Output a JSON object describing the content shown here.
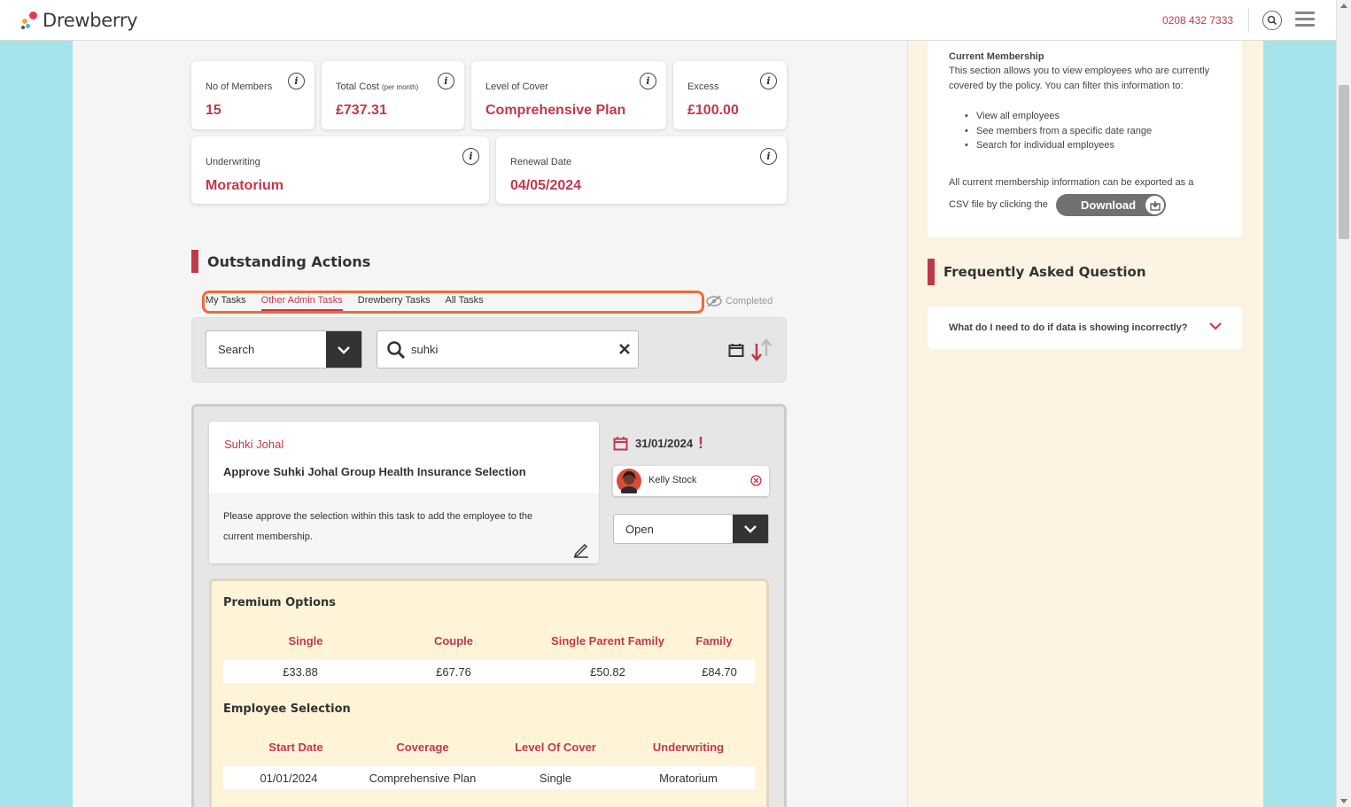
{
  "header": {
    "brand": "Drewberry",
    "phone": "0208 432 7333"
  },
  "stats": {
    "members": {
      "label": "No of Members",
      "value": "15"
    },
    "cost": {
      "label": "Total Cost",
      "sub": "(per month)",
      "value": "£737.31"
    },
    "cover": {
      "label": "Level of Cover",
      "value": "Comprehensive Plan"
    },
    "excess": {
      "label": "Excess",
      "value": "£100.00"
    },
    "underwriting": {
      "label": "Underwriting",
      "value": "Moratorium"
    },
    "renewal": {
      "label": "Renewal Date",
      "value": "04/05/2024"
    }
  },
  "actions": {
    "title": "Outstanding Actions",
    "tabs": [
      "My Tasks",
      "Other Admin Tasks",
      "Drewberry Tasks",
      "All Tasks"
    ],
    "completed": "Completed",
    "filter": {
      "select": "Search",
      "query": "suhki"
    }
  },
  "task": {
    "name": "Suhki Johal",
    "title": "Approve Suhki Johal Group Health Insurance Selection",
    "desc_line1": "Please approve the selection within this task to add the employee to the",
    "desc_line2": "current membership.",
    "date": "31/01/2024",
    "urgent": "!",
    "assignee": "Kelly Stock",
    "status": "Open"
  },
  "premium": {
    "title": "Premium Options",
    "headers": [
      "Single",
      "Couple",
      "Single Parent Family",
      "Family"
    ],
    "values": [
      "£33.88",
      "£67.76",
      "£50.82",
      "£84.70"
    ]
  },
  "employee": {
    "title": "Employee Selection",
    "headers": [
      "Start Date",
      "Coverage",
      "Level Of Cover",
      "Underwriting"
    ],
    "values": [
      "01/01/2024",
      "Comprehensive Plan",
      "Single",
      "Moratorium"
    ]
  },
  "sidebar": {
    "membership_title": "Current Membership",
    "intro1": "This section allows you to view employees who are currently",
    "intro2": "covered by the policy. You can filter this information to:",
    "bullets": [
      "View all employees",
      "See members from a specific date range",
      "Search for individual employees"
    ],
    "export1": "All current membership information can be exported as a",
    "export2": "CSV file by clicking the",
    "download": "Download",
    "faq_title": "Frequently Asked Question",
    "faq_q": "What do I need to do if data is showing incorrectly?"
  },
  "colors": {
    "accent": "#c0394b",
    "highlight": "#f06a3a",
    "bg": "#a6e3ea"
  }
}
